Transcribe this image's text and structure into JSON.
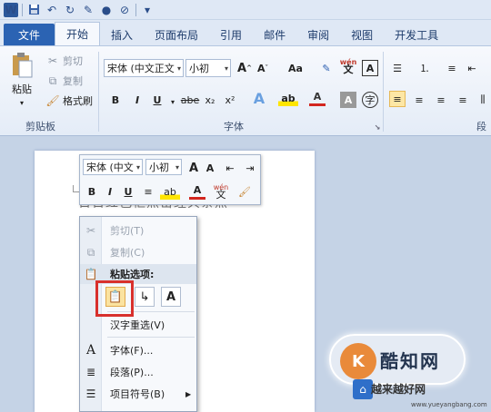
{
  "qat": {
    "logo": "W",
    "save_icon": "save-icon",
    "undo_icon": "undo-icon",
    "redo_icon": "redo-icon"
  },
  "tabs": [
    {
      "label": "文件"
    },
    {
      "label": "开始"
    },
    {
      "label": "插入"
    },
    {
      "label": "页面布局"
    },
    {
      "label": "引用"
    },
    {
      "label": "邮件"
    },
    {
      "label": "审阅"
    },
    {
      "label": "视图"
    },
    {
      "label": "开发工具"
    }
  ],
  "ribbon": {
    "clipboard": {
      "paste": "粘贴",
      "cut": "剪切",
      "copy": "复制",
      "format_painter": "格式刷",
      "group": "剪贴板"
    },
    "font": {
      "font_name": "宋体 (中文正文",
      "font_size": "小初",
      "group": "字体",
      "bold": "B",
      "italic": "I",
      "underline": "U",
      "strike": "abe",
      "sub": "x₂",
      "sup": "x²",
      "aa": "Aa",
      "wen": "wén",
      "charA": "A"
    },
    "paragraph": {
      "group": "段"
    }
  },
  "document": {
    "text": "日日红色框点击经典条点"
  },
  "mini_toolbar": {
    "font_name": "宋体 (中文",
    "font_size": "小初",
    "bold": "B",
    "italic": "I",
    "underline": "U"
  },
  "context_menu": {
    "cut": "剪切(T)",
    "copy": "复制(C)",
    "paste_options": "粘贴选项:",
    "hanzi": "汉字重选(V)",
    "font": "字体(F)...",
    "paragraph": "段落(P)...",
    "bullets": "项目符号(B)"
  },
  "watermark": {
    "brand": "酷知网",
    "sub": "越来越好网",
    "url": "www.yueyangbang.com",
    "logo_char": "K"
  },
  "colors": {
    "file_tab": "#2b63b3",
    "highlight": "#d8302c",
    "selected": "#fde7a5"
  }
}
